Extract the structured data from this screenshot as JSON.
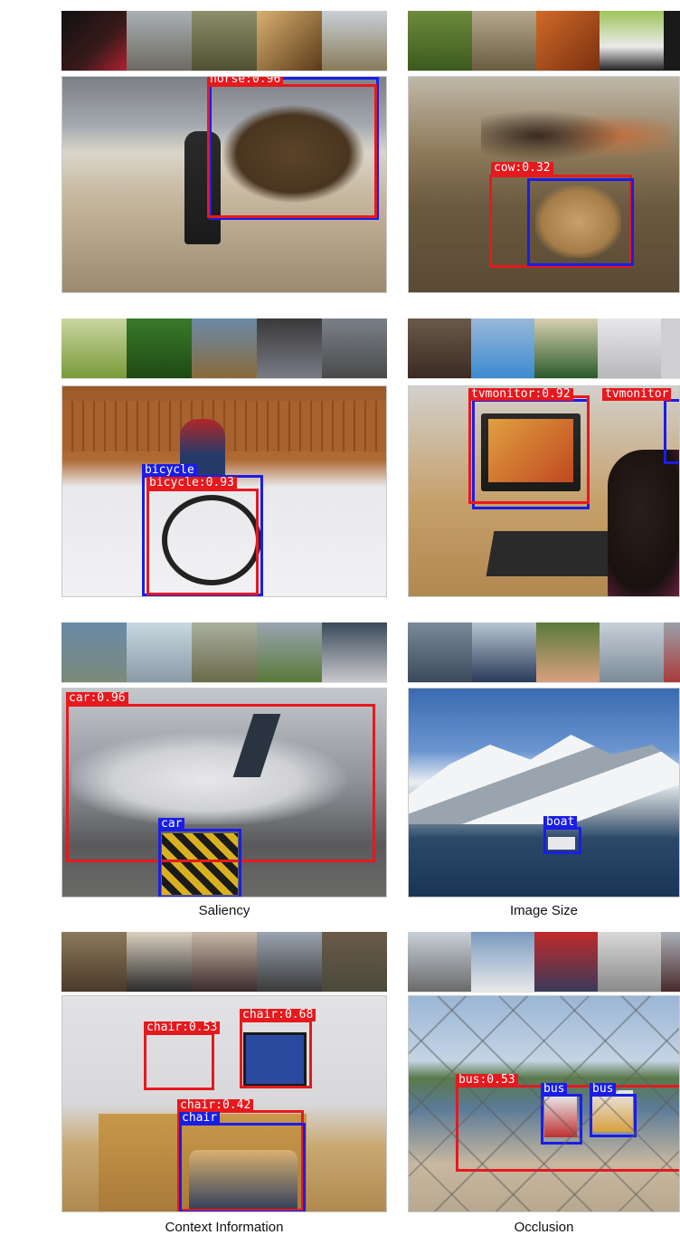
{
  "colors": {
    "red_box": "#e6191e",
    "blue_box": "#1a1de6"
  },
  "panels": {
    "horse": {
      "detection": "horse:0.96"
    },
    "cow": {
      "detection": "cow:0.32"
    },
    "bicycle": {
      "detection_blue": "bicycle",
      "detection_red": "bicycle:0.93"
    },
    "tvmonitor": {
      "detection_1": "tvmonitor:0.92",
      "detection_2": "tvmonitor"
    },
    "car": {
      "detection_red": "car:0.96",
      "detection_blue": "car"
    },
    "boat": {
      "detection": "boat"
    },
    "chair": {
      "detection_1": "chair:0.53",
      "detection_2": "chair:0.68",
      "detection_3": "chair:0.42",
      "detection_blue": "chair"
    },
    "bus": {
      "detection_red": "bus:0.53",
      "detection_blue_1": "bus",
      "detection_blue_2": "bus"
    }
  },
  "captions": {
    "saliency": "Saliency",
    "image_size": "Image Size",
    "context_information": "Context Information",
    "occlusion": "Occlusion"
  }
}
